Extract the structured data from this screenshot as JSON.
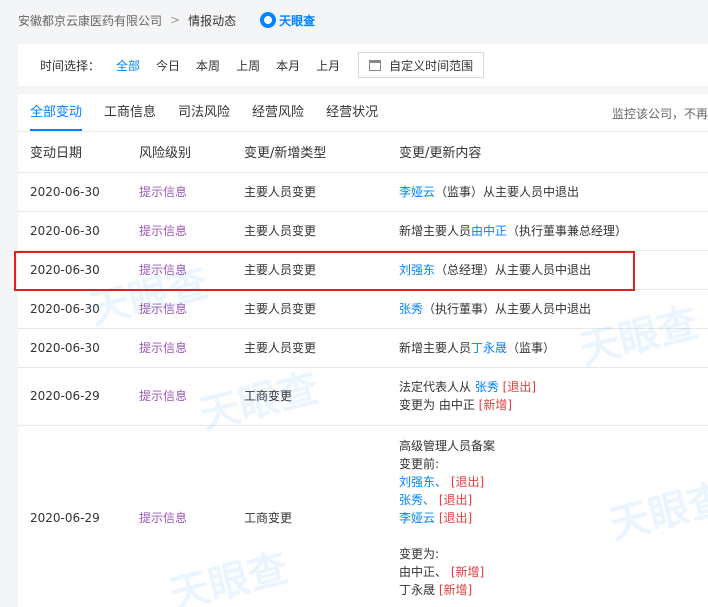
{
  "breadcrumb": {
    "company": "安徽都京云康医药有限公司",
    "sep": ">",
    "current": "情报动态",
    "logo": "天眼查"
  },
  "filter": {
    "label": "时间选择：",
    "options": [
      "全部",
      "今日",
      "本周",
      "上周",
      "本月",
      "上月"
    ],
    "active": "全部",
    "custom": "自定义时间范围"
  },
  "tabs": {
    "items": [
      "全部变动",
      "工商信息",
      "司法风险",
      "经营风险",
      "经营状况"
    ],
    "active": "全部变动",
    "monitor": "监控该公司，不再"
  },
  "table": {
    "headers": [
      "变动日期",
      "风险级别",
      "变更/新增类型",
      "变更/更新内容"
    ],
    "rows": [
      {
        "date": "2020-06-30",
        "risk": "提示信息",
        "type": "主要人员变更",
        "parts": [
          [
            "李娅云",
            "link"
          ],
          [
            "（监事）从主要人员中退出",
            ""
          ]
        ]
      },
      {
        "date": "2020-06-30",
        "risk": "提示信息",
        "type": "主要人员变更",
        "parts": [
          [
            "新增主要人员",
            ""
          ],
          [
            "由中正",
            "link"
          ],
          [
            "（执行董事兼总经理）",
            ""
          ]
        ]
      },
      {
        "date": "2020-06-30",
        "risk": "提示信息",
        "type": "主要人员变更",
        "parts": [
          [
            "刘强东",
            "link"
          ],
          [
            "（总经理）从主要人员中退出",
            ""
          ]
        ]
      },
      {
        "date": "2020-06-30",
        "risk": "提示信息",
        "type": "主要人员变更",
        "parts": [
          [
            "张秀",
            "link"
          ],
          [
            "（执行董事）从主要人员中退出",
            ""
          ]
        ]
      },
      {
        "date": "2020-06-30",
        "risk": "提示信息",
        "type": "主要人员变更",
        "parts": [
          [
            "新增主要人员",
            ""
          ],
          [
            "丁永晟",
            "link"
          ],
          [
            "（监事）",
            ""
          ]
        ]
      }
    ],
    "row6": {
      "date": "2020-06-29",
      "risk": "提示信息",
      "type": "工商变更",
      "line1_prefix": "法定代表人从 ",
      "line1_name": "张秀",
      "line1_tag": "[退出]",
      "line2_prefix": "变更为 ",
      "line2_name": "由中正",
      "line2_tag": "[新增]"
    },
    "row7": {
      "date": "2020-06-29",
      "risk": "提示信息",
      "type": "工商变更",
      "title": "高级管理人员备案",
      "before_label": "变更前:",
      "before": [
        [
          "刘强东、",
          "[退出]"
        ],
        [
          "张秀、",
          "[退出]"
        ],
        [
          "李娅云",
          "[退出]"
        ]
      ],
      "after_label": "变更为:",
      "after": [
        [
          "由中正、",
          "[新增]"
        ],
        [
          "丁永晟",
          "[新增]"
        ]
      ]
    }
  }
}
